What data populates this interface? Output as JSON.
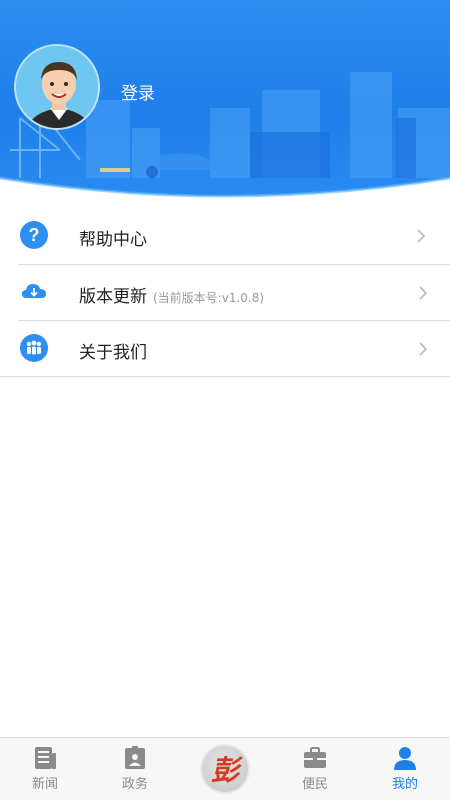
{
  "profile": {
    "login_label": "登录"
  },
  "menu": {
    "items": [
      {
        "label": "帮助中心",
        "sub": ""
      },
      {
        "label": "版本更新",
        "sub": "(当前版本号:v1.0.8)"
      },
      {
        "label": "关于我们",
        "sub": ""
      }
    ]
  },
  "tabbar": {
    "tabs": [
      {
        "label": "新闻"
      },
      {
        "label": "政务"
      },
      {
        "label": ""
      },
      {
        "label": "便民"
      },
      {
        "label": "我的"
      }
    ],
    "center_glyph": "彭",
    "active_index": 4
  },
  "colors": {
    "accent": "#1f80e6",
    "header": "#2b8df0",
    "icon_bg": "#2f8ff0",
    "tab_inactive": "#8a8a8a"
  }
}
